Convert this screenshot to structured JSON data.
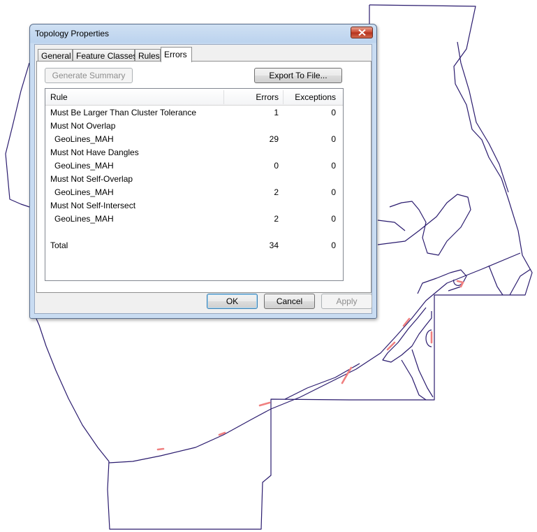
{
  "dialog": {
    "title": "Topology Properties",
    "tabs": [
      {
        "label": "General",
        "active": false
      },
      {
        "label": "Feature Classes",
        "active": false
      },
      {
        "label": "Rules",
        "active": false
      },
      {
        "label": "Errors",
        "active": true
      }
    ],
    "generate_summary_label": "Generate Summary",
    "export_label": "Export To File...",
    "columns": {
      "rule": "Rule",
      "errors": "Errors",
      "exceptions": "Exceptions"
    },
    "rows": [
      {
        "rule": "Must Be Larger Than Cluster Tolerance",
        "errors": "1",
        "exceptions": "0",
        "indent": false
      },
      {
        "rule": "Must Not Overlap",
        "errors": "",
        "exceptions": "",
        "indent": false
      },
      {
        "rule": "GeoLines_MAH",
        "errors": "29",
        "exceptions": "0",
        "indent": true
      },
      {
        "rule": "Must Not Have Dangles",
        "errors": "",
        "exceptions": "",
        "indent": false
      },
      {
        "rule": "GeoLines_MAH",
        "errors": "0",
        "exceptions": "0",
        "indent": true
      },
      {
        "rule": "Must Not Self-Overlap",
        "errors": "",
        "exceptions": "",
        "indent": false
      },
      {
        "rule": "GeoLines_MAH",
        "errors": "2",
        "exceptions": "0",
        "indent": true
      },
      {
        "rule": "Must Not Self-Intersect",
        "errors": "",
        "exceptions": "",
        "indent": false
      },
      {
        "rule": "GeoLines_MAH",
        "errors": "2",
        "exceptions": "0",
        "indent": true
      }
    ],
    "total": {
      "label": "Total",
      "errors": "34",
      "exceptions": "0"
    },
    "ok_label": "OK",
    "cancel_label": "Cancel",
    "apply_label": "Apply"
  },
  "colors": {
    "map_line": "#2a1b6e",
    "error_mark": "#f08080",
    "title_bar": "#bcd3ee",
    "close_button": "#c9452c"
  }
}
